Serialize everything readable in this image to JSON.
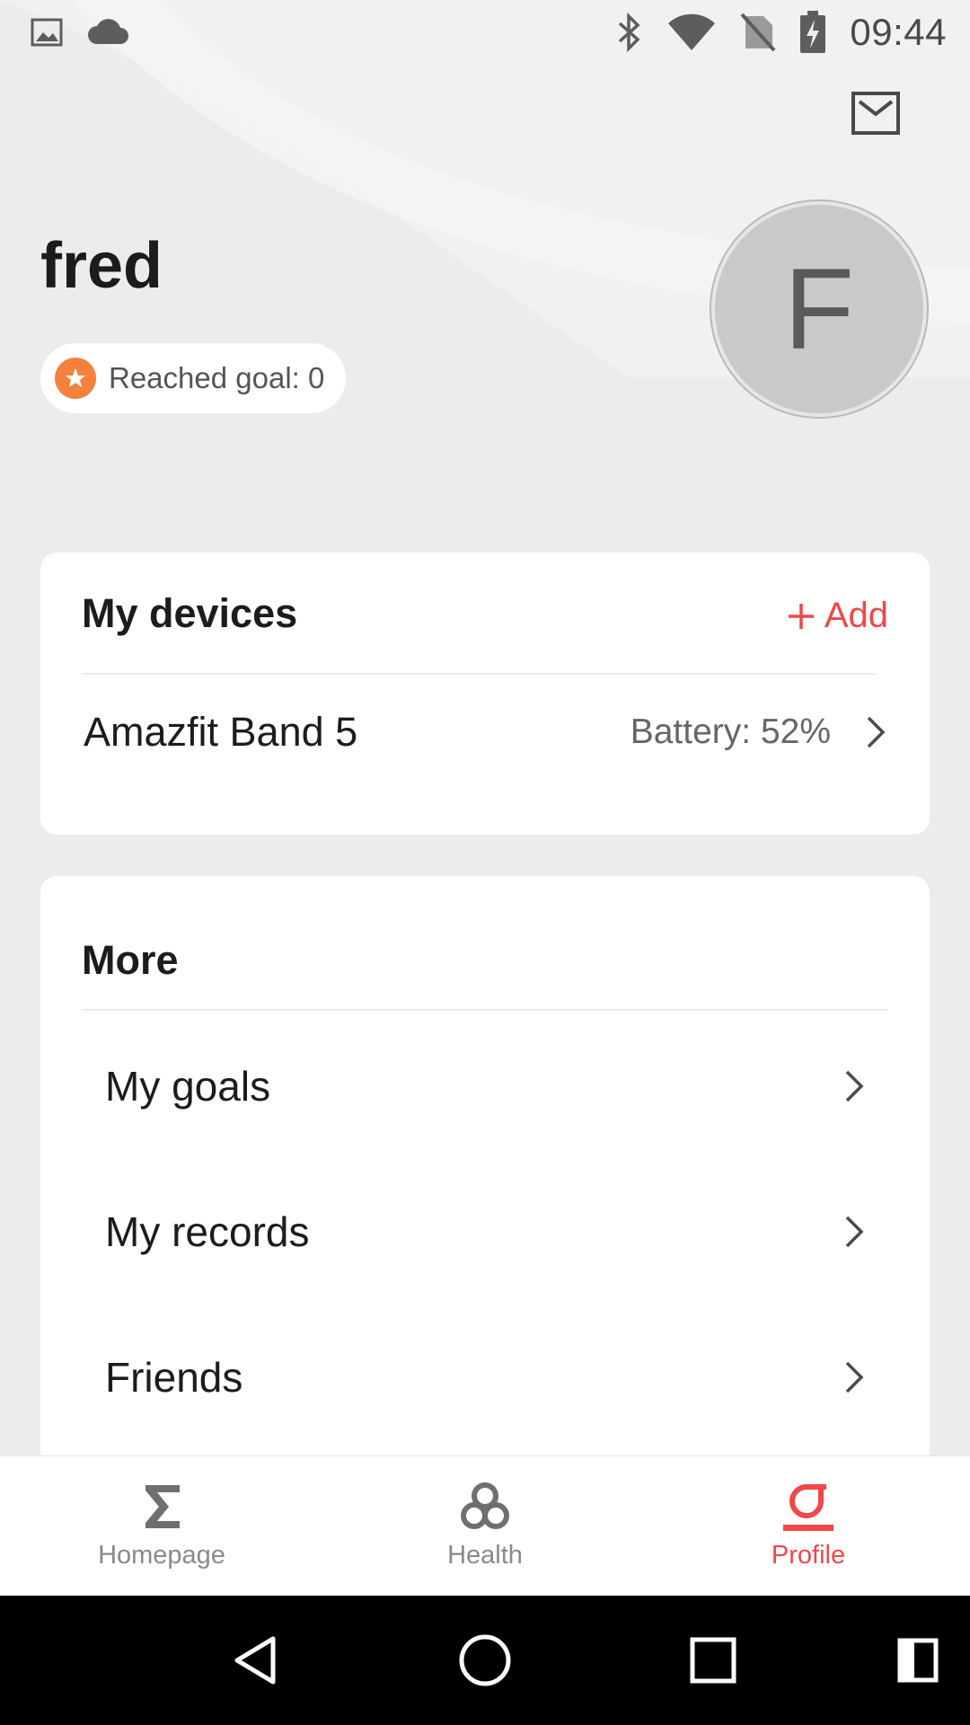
{
  "status_bar": {
    "time": "09:44",
    "icons": [
      "image-icon",
      "cloud-icon",
      "bluetooth-icon",
      "wifi-icon",
      "no-sim-icon",
      "battery-charging-icon"
    ]
  },
  "header": {
    "mail_icon": "mail-icon",
    "username": "fred",
    "goal_label": "Reached goal: 0",
    "avatar_letter": "F"
  },
  "devices": {
    "title": "My devices",
    "add_label": "Add",
    "items": [
      {
        "name": "Amazfit Band 5",
        "battery": "Battery: 52%"
      }
    ]
  },
  "more": {
    "title": "More",
    "items": [
      {
        "label": "My goals"
      },
      {
        "label": "My records"
      },
      {
        "label": "Friends"
      }
    ]
  },
  "bottom_nav": {
    "items": [
      {
        "label": "Homepage",
        "icon": "sigma-icon",
        "active": false
      },
      {
        "label": "Health",
        "icon": "health-knot-icon",
        "active": false
      },
      {
        "label": "Profile",
        "icon": "profile-icon",
        "active": true
      }
    ]
  },
  "colors": {
    "accent": "#f04848",
    "goal_star": "#f5813d",
    "background": "#ececee"
  }
}
